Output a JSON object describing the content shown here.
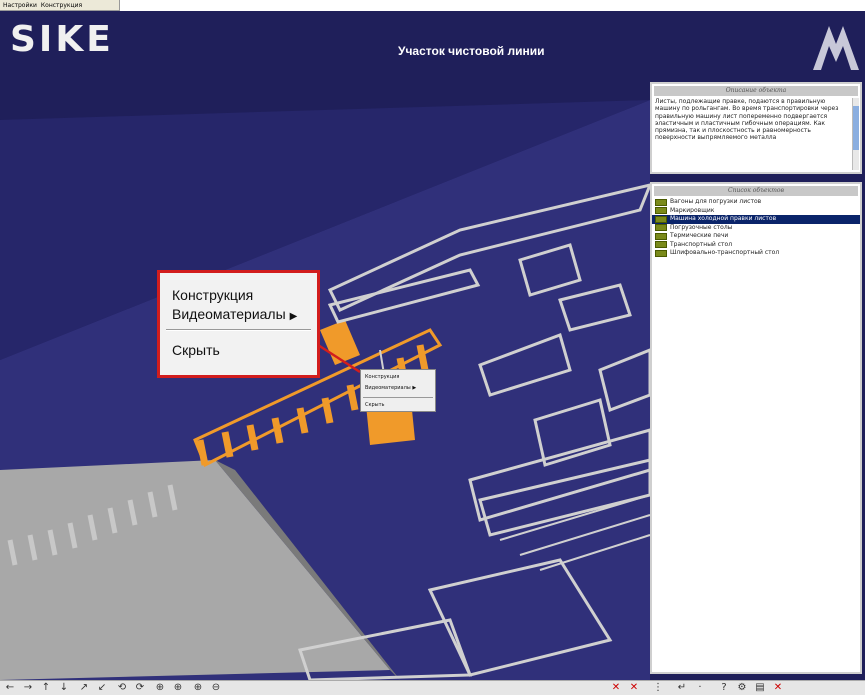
{
  "menubar": {
    "items": [
      "Настройки",
      "Конструкция"
    ]
  },
  "header": {
    "logo": "SIKE",
    "title": "Участок чистовой линии"
  },
  "description_panel": {
    "title": "Описание объекта",
    "text": "Листы, подлежащие правке, подаются в правильную машину по рольгангам. Во время транспортировки через правильную машину лист попеременно подвергается эластичным и пластичным гибочным операциям. Как прямизна, так и плоскостность и равномерность поверхности выпрямляемого металла"
  },
  "objects_panel": {
    "title": "Список объектов",
    "items": [
      "Вагоны для погрузки листов",
      "Маркировщик",
      "Машина холодной правки листов",
      "Погрузочные столы",
      "Термические печи",
      "Транспортный стол",
      "Шлифовально-транспортный стол"
    ],
    "selected": "Машина холодной правки листов"
  },
  "context_menu_zoomed": {
    "construction": "Конструкция",
    "videos": "Видеоматериалы",
    "hide": "Скрыть"
  },
  "context_menu": {
    "construction": "Конструкция",
    "videos": "Видеоматериалы",
    "hide": "Скрыть"
  },
  "colors": {
    "background": "#1f1f5a",
    "highlight": "#f09a2a",
    "accent_red": "#d21d1d",
    "selection": "#0a246a"
  }
}
